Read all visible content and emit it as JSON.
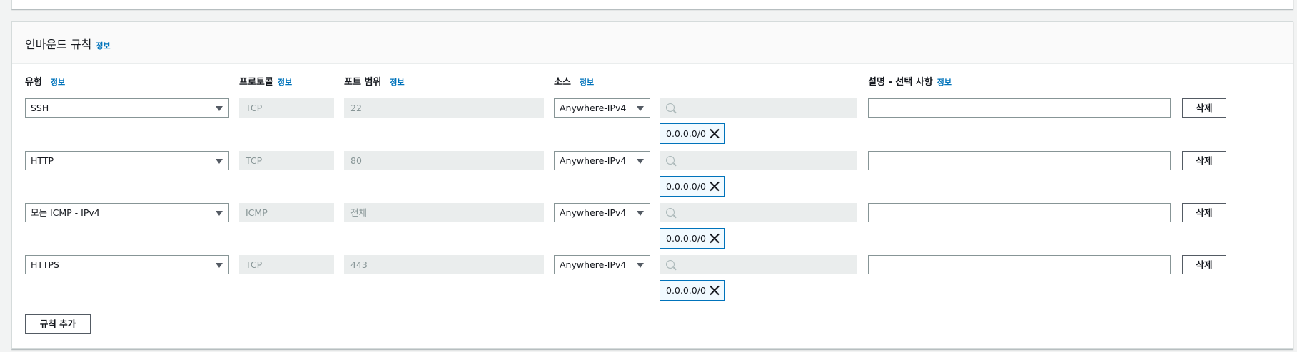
{
  "section": {
    "title": "인바운드 규칙",
    "info_label": "정보"
  },
  "columns": {
    "type": "유형",
    "protocol": "프로토콜",
    "port_range": "포트 범위",
    "source": "소스",
    "description": "설명 - 선택 사항",
    "info_label": "정보"
  },
  "rules": [
    {
      "type": "SSH",
      "protocol": "TCP",
      "port": "22",
      "source": "Anywhere-IPv4",
      "cidr": "0.0.0.0/0",
      "search_placeholder": "",
      "description": "",
      "delete_label": "삭제"
    },
    {
      "type": "HTTP",
      "protocol": "TCP",
      "port": "80",
      "source": "Anywhere-IPv4",
      "cidr": "0.0.0.0/0",
      "search_placeholder": "",
      "description": "",
      "delete_label": "삭제"
    },
    {
      "type": "모든 ICMP - IPv4",
      "protocol": "ICMP",
      "port": "전체",
      "source": "Anywhere-IPv4",
      "cidr": "0.0.0.0/0",
      "search_placeholder": "",
      "description": "",
      "delete_label": "삭제"
    },
    {
      "type": "HTTPS",
      "protocol": "TCP",
      "port": "443",
      "source": "Anywhere-IPv4",
      "cidr": "0.0.0.0/0",
      "search_placeholder": "",
      "description": "",
      "delete_label": "삭제"
    }
  ],
  "add_rule_label": "규칙 추가",
  "colors": {
    "link": "#0073bb",
    "border": "#879596",
    "disabled_bg": "#eaeded",
    "token_border": "#0073bb"
  }
}
